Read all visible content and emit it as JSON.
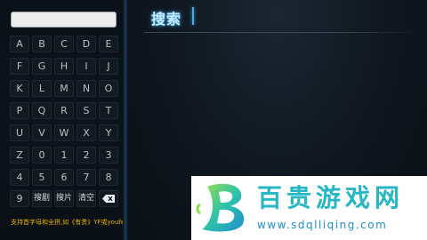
{
  "search_input": {
    "value": ""
  },
  "keyboard": {
    "rows": [
      [
        "A",
        "B",
        "C",
        "D",
        "E"
      ],
      [
        "F",
        "G",
        "H",
        "I",
        "J"
      ],
      [
        "K",
        "L",
        "M",
        "N",
        "O"
      ],
      [
        "P",
        "Q",
        "R",
        "S",
        "T"
      ],
      [
        "U",
        "V",
        "W",
        "X",
        "Y"
      ],
      [
        "Z",
        "0",
        "1",
        "2",
        "3"
      ],
      [
        "4",
        "5",
        "6",
        "7",
        "8"
      ]
    ],
    "last_row": {
      "digit": "9",
      "search_play": "搜剧",
      "search_film": "搜片",
      "clear": "清空",
      "backspace_icon": "backspace-icon"
    }
  },
  "hint": "支持首字母和全拼,如《有贵》YF或youfei",
  "page": {
    "title": "搜索"
  },
  "watermark": {
    "brand": "百贵游戏网",
    "url": "www.sdqlliqing.com",
    "logo_icon": "b-logo-icon"
  },
  "colors": {
    "accent": "#4aa9e8",
    "hint": "#e8b400",
    "watermark_text": "#27b7c4"
  }
}
